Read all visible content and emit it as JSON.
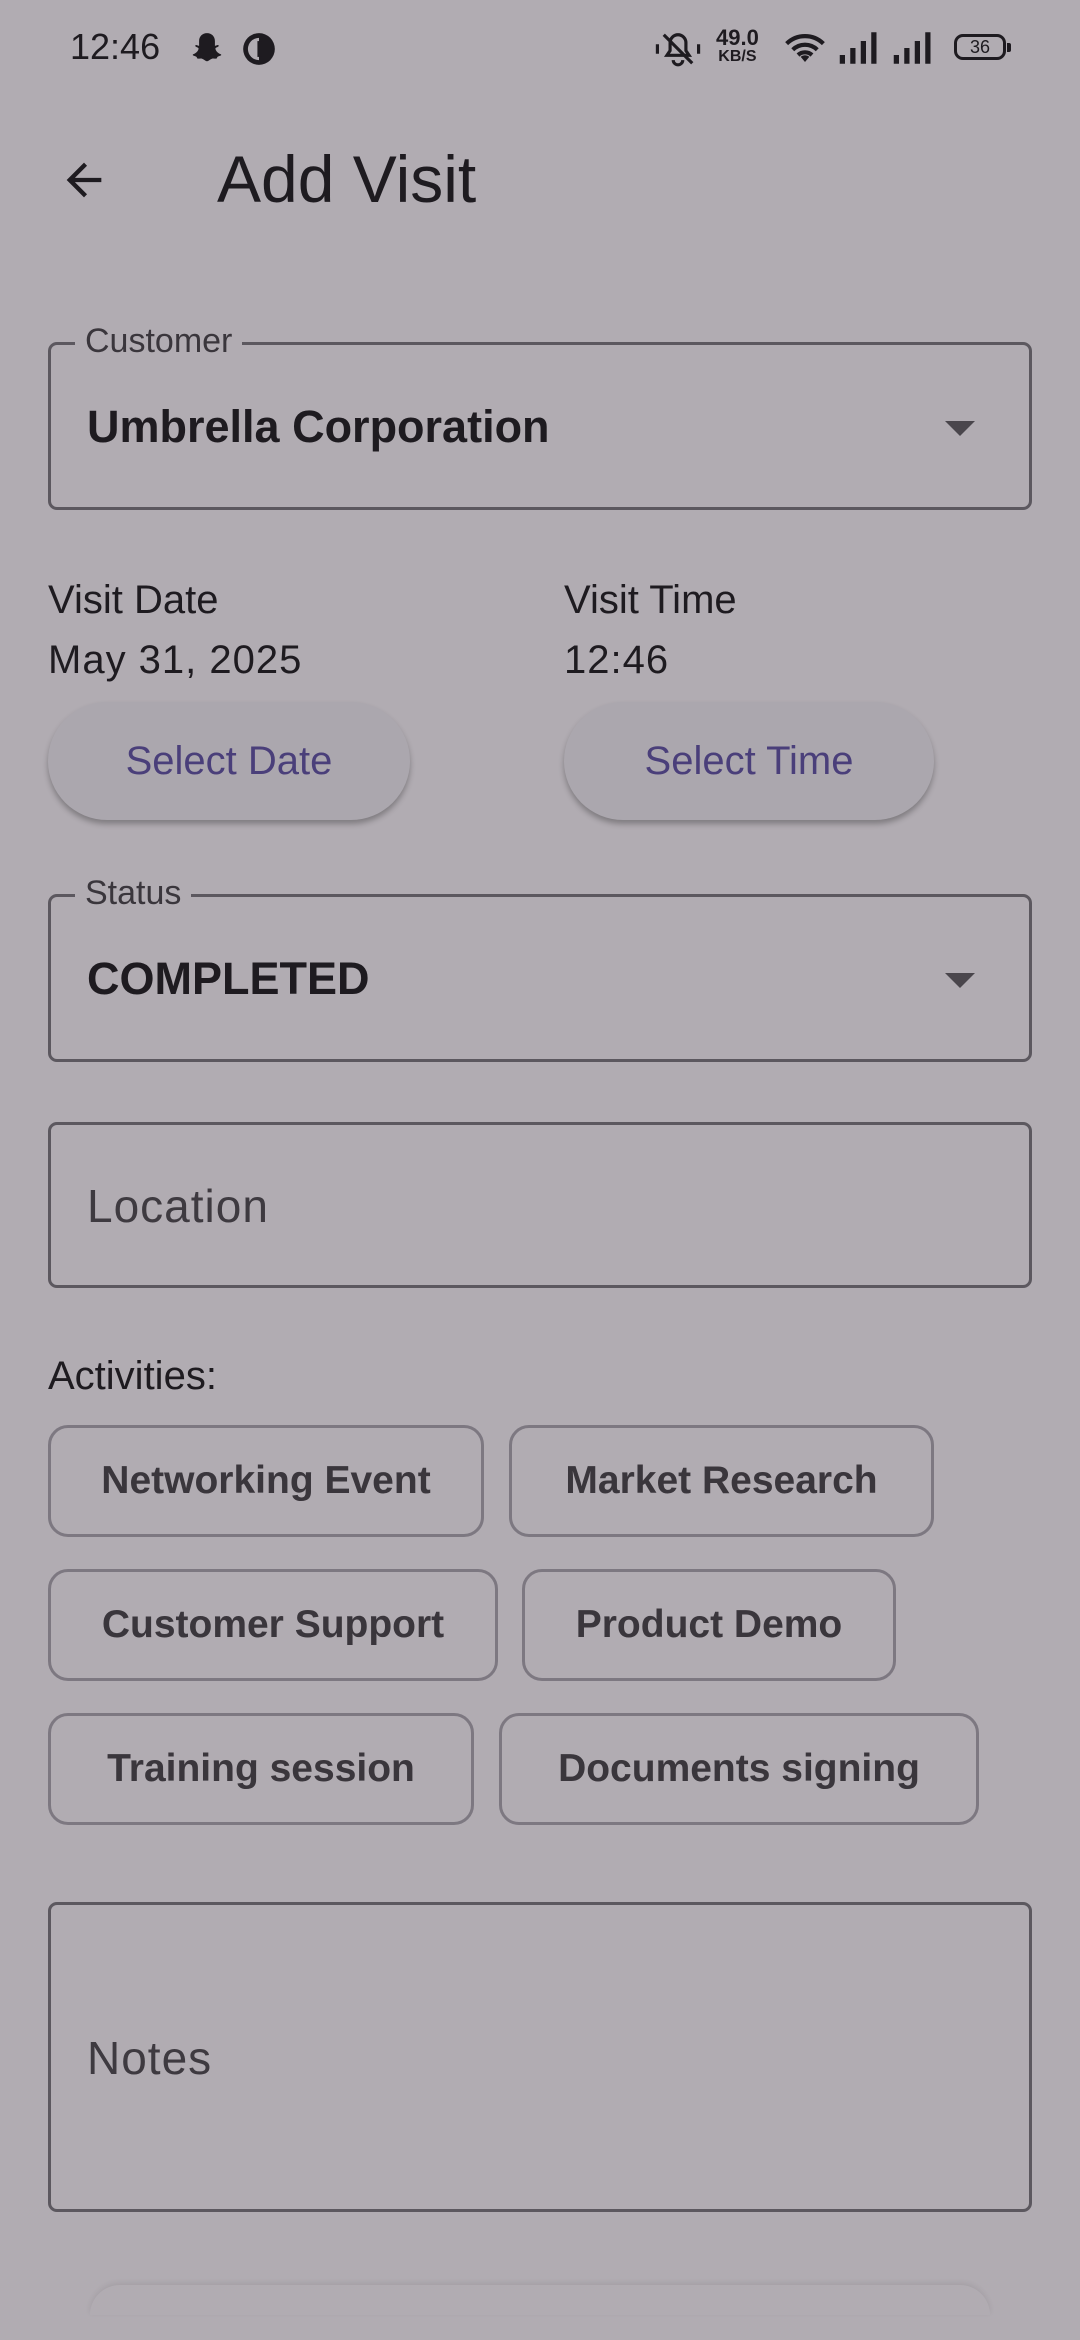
{
  "status_bar": {
    "time": "12:46",
    "net_speed_value": "49.0",
    "net_speed_unit": "KB/S",
    "battery": "36",
    "icons": [
      "snapchat-icon",
      "app-notification-icon",
      "mute-icon",
      "wifi-icon",
      "signal-icon",
      "signal-icon",
      "battery-icon"
    ]
  },
  "app_bar": {
    "back_icon": "arrow-back-icon",
    "title": "Add Visit"
  },
  "form": {
    "customer": {
      "label": "Customer",
      "value": "Umbrella Corporation"
    },
    "visit_date": {
      "label": "Visit Date",
      "value": "May 31, 2025",
      "button": "Select Date"
    },
    "visit_time": {
      "label": "Visit Time",
      "value": "12:46",
      "button": "Select Time"
    },
    "status": {
      "label": "Status",
      "value": "COMPLETED"
    },
    "location": {
      "placeholder": "Location"
    },
    "activities": {
      "label": "Activities:",
      "chips": [
        "Networking Event",
        "Market Research",
        "Customer Support",
        "Product Demo",
        "Training session",
        "Documents signing"
      ]
    },
    "notes": {
      "placeholder": "Notes"
    }
  },
  "colors": {
    "background": "#b1acb2",
    "button_text": "#4a3f7a",
    "outline": "#5c585f"
  }
}
